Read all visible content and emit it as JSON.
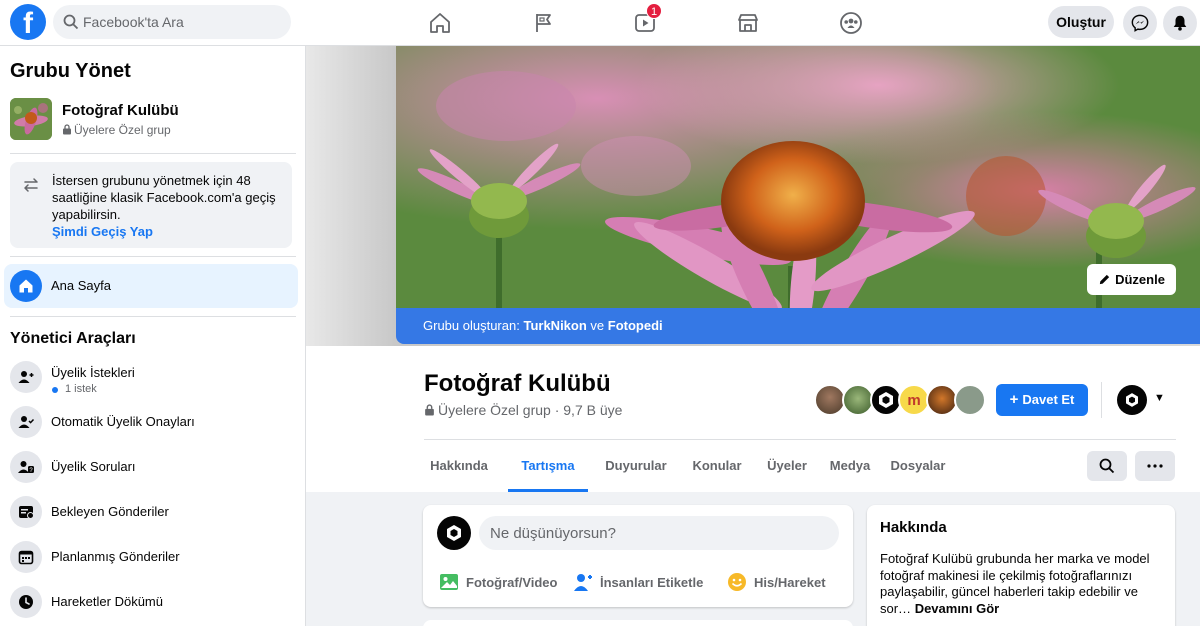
{
  "topbar": {
    "logo": "f",
    "search_placeholder": "Facebook'ta Ara",
    "video_badge": "1",
    "create_label": "Oluştur",
    "icons": [
      "home-icon",
      "flag-icon",
      "video-icon",
      "marketplace-icon",
      "groups-icon",
      "messenger-icon",
      "notifications-icon"
    ]
  },
  "sidebar": {
    "title": "Grubu Yönet",
    "group_name": "Fotoğraf Kulübü",
    "group_privacy": "Üyelere Özel grup",
    "notice_text": "İstersen grubunu yönetmek için 48 saatliğine klasik Facebook.com'a geçiş yapabilirsin.",
    "notice_link": "Şimdi Geçiş Yap",
    "home_label": "Ana Sayfa",
    "admin_tools_title": "Yönetici Araçları",
    "items": [
      {
        "label": "Üyelik İstekleri",
        "sub": "1 istek"
      },
      {
        "label": "Otomatik Üyelik Onayları"
      },
      {
        "label": "Üyelik Soruları"
      },
      {
        "label": "Bekleyen Gönderiler"
      },
      {
        "label": "Planlanmış Gönderiler"
      },
      {
        "label": "Hareketler Dökümü"
      }
    ]
  },
  "cover": {
    "edit_label": "Düzenle",
    "creator_prefix": "Grubu oluşturan:",
    "creator_1": "TurkNikon",
    "creator_joiner": "ve",
    "creator_2": "Fotopedi"
  },
  "group": {
    "title": "Fotoğraf Kulübü",
    "meta": "Üyelere Özel grup · 9,7 B üye",
    "invite_label": "Davet Et",
    "tabs": [
      "Hakkında",
      "Tartışma",
      "Duyurular",
      "Konular",
      "Üyeler",
      "Medya",
      "Dosyalar"
    ],
    "active_tab": "Tartışma"
  },
  "composer": {
    "placeholder": "Ne düşünüyorsun?",
    "actions": [
      "Fotoğraf/Video",
      "İnsanları Etiketle",
      "His/Hareket"
    ]
  },
  "about": {
    "title": "Hakkında",
    "description": "Fotoğraf Kulübü grubunda her marka ve model fotoğraf makinesi ile çekilmiş fotoğraflarınızı paylaşabilir, güncel haberleri takip edebilir ve sor…",
    "more": "Devamını Gör"
  },
  "colors": {
    "brand": "#1877f2",
    "creator_bar": "#3578e5",
    "badge": "#e41e3f"
  }
}
